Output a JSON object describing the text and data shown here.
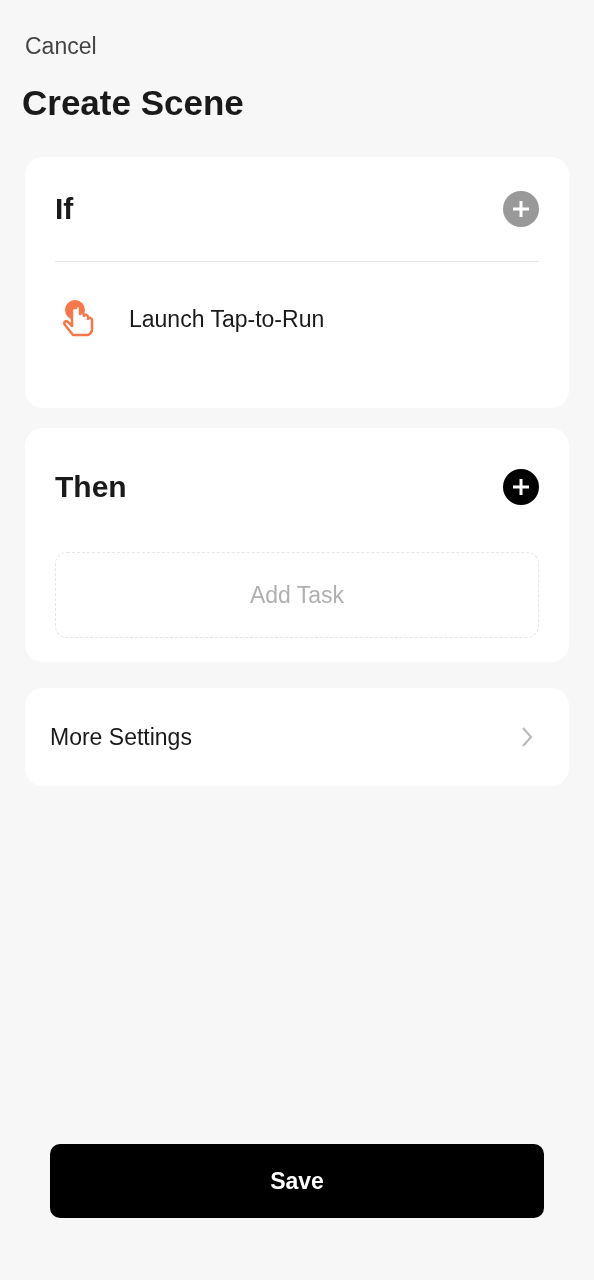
{
  "header": {
    "cancel": "Cancel",
    "title": "Create Scene"
  },
  "sections": [
    {
      "title": "If",
      "add_disabled": true,
      "items": [
        {
          "label": "Launch Tap-to-Run"
        }
      ]
    },
    {
      "title": "Then",
      "add_disabled": false,
      "placeholder": "Add Task"
    }
  ],
  "more_settings": {
    "label": "More Settings"
  },
  "save": {
    "label": "Save"
  }
}
